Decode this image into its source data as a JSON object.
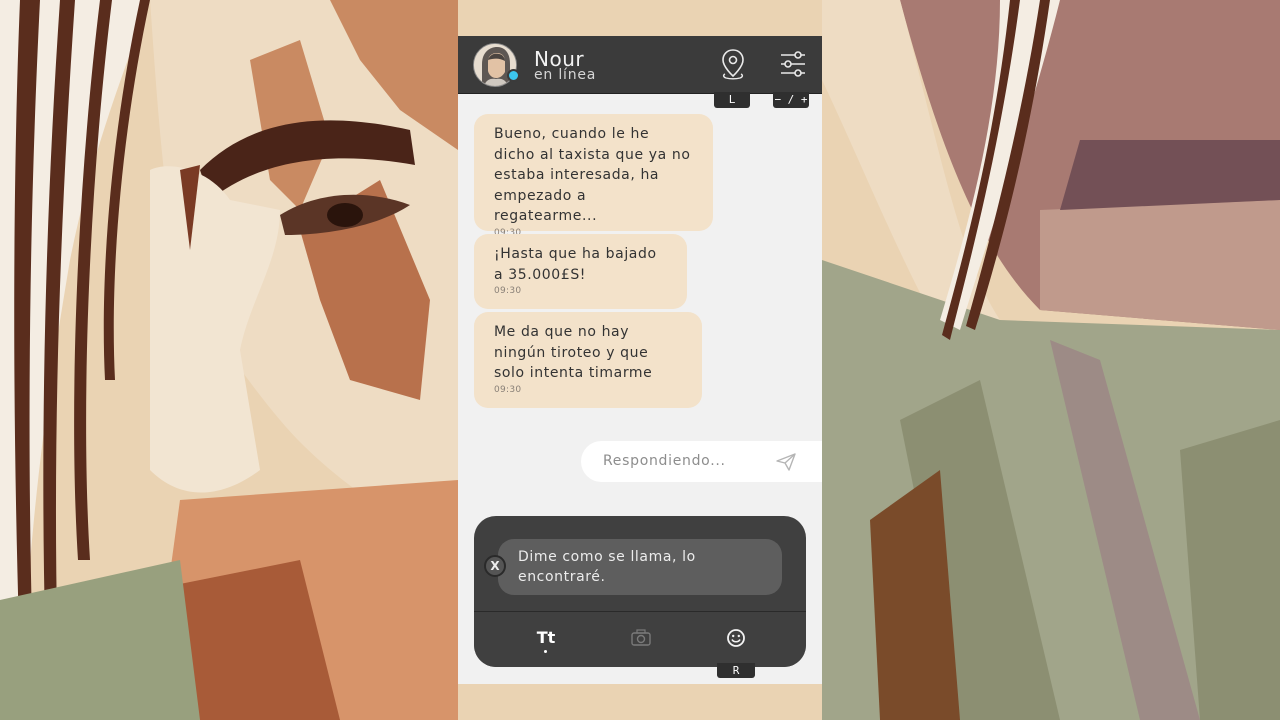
{
  "contact": {
    "name": "Nour",
    "status": "en línea",
    "status_color": "#3cc6ee"
  },
  "header_buttons": {
    "location": {
      "icon": "location-pin-icon",
      "key_hint": "L"
    },
    "settings": {
      "icon": "sliders-icon",
      "key_hint": "− / +"
    }
  },
  "messages": [
    {
      "text": "Bueno, cuando le he dicho al taxista que ya no estaba interesada, ha empezado a regatearme...",
      "time": "09:30"
    },
    {
      "text": "¡Hasta que ha bajado a 35.000£S!",
      "time": "09:30"
    },
    {
      "text": "Me da que no hay ningún tiroteo y que solo intenta timarme",
      "time": "09:30"
    }
  ],
  "reply": {
    "placeholder": "Respondiendo...",
    "icon": "send-icon"
  },
  "composer": {
    "option_key": "X",
    "option_text": "Dime como se llama, lo encontraré.",
    "tools": {
      "text_label": "Tt",
      "camera_icon": "camera-icon",
      "emoji_icon": "emoji-icon",
      "key_hint": "R"
    }
  },
  "colors": {
    "header": "#3b3b3b",
    "bubble": "#f3e2ca",
    "composer": "#404040"
  }
}
